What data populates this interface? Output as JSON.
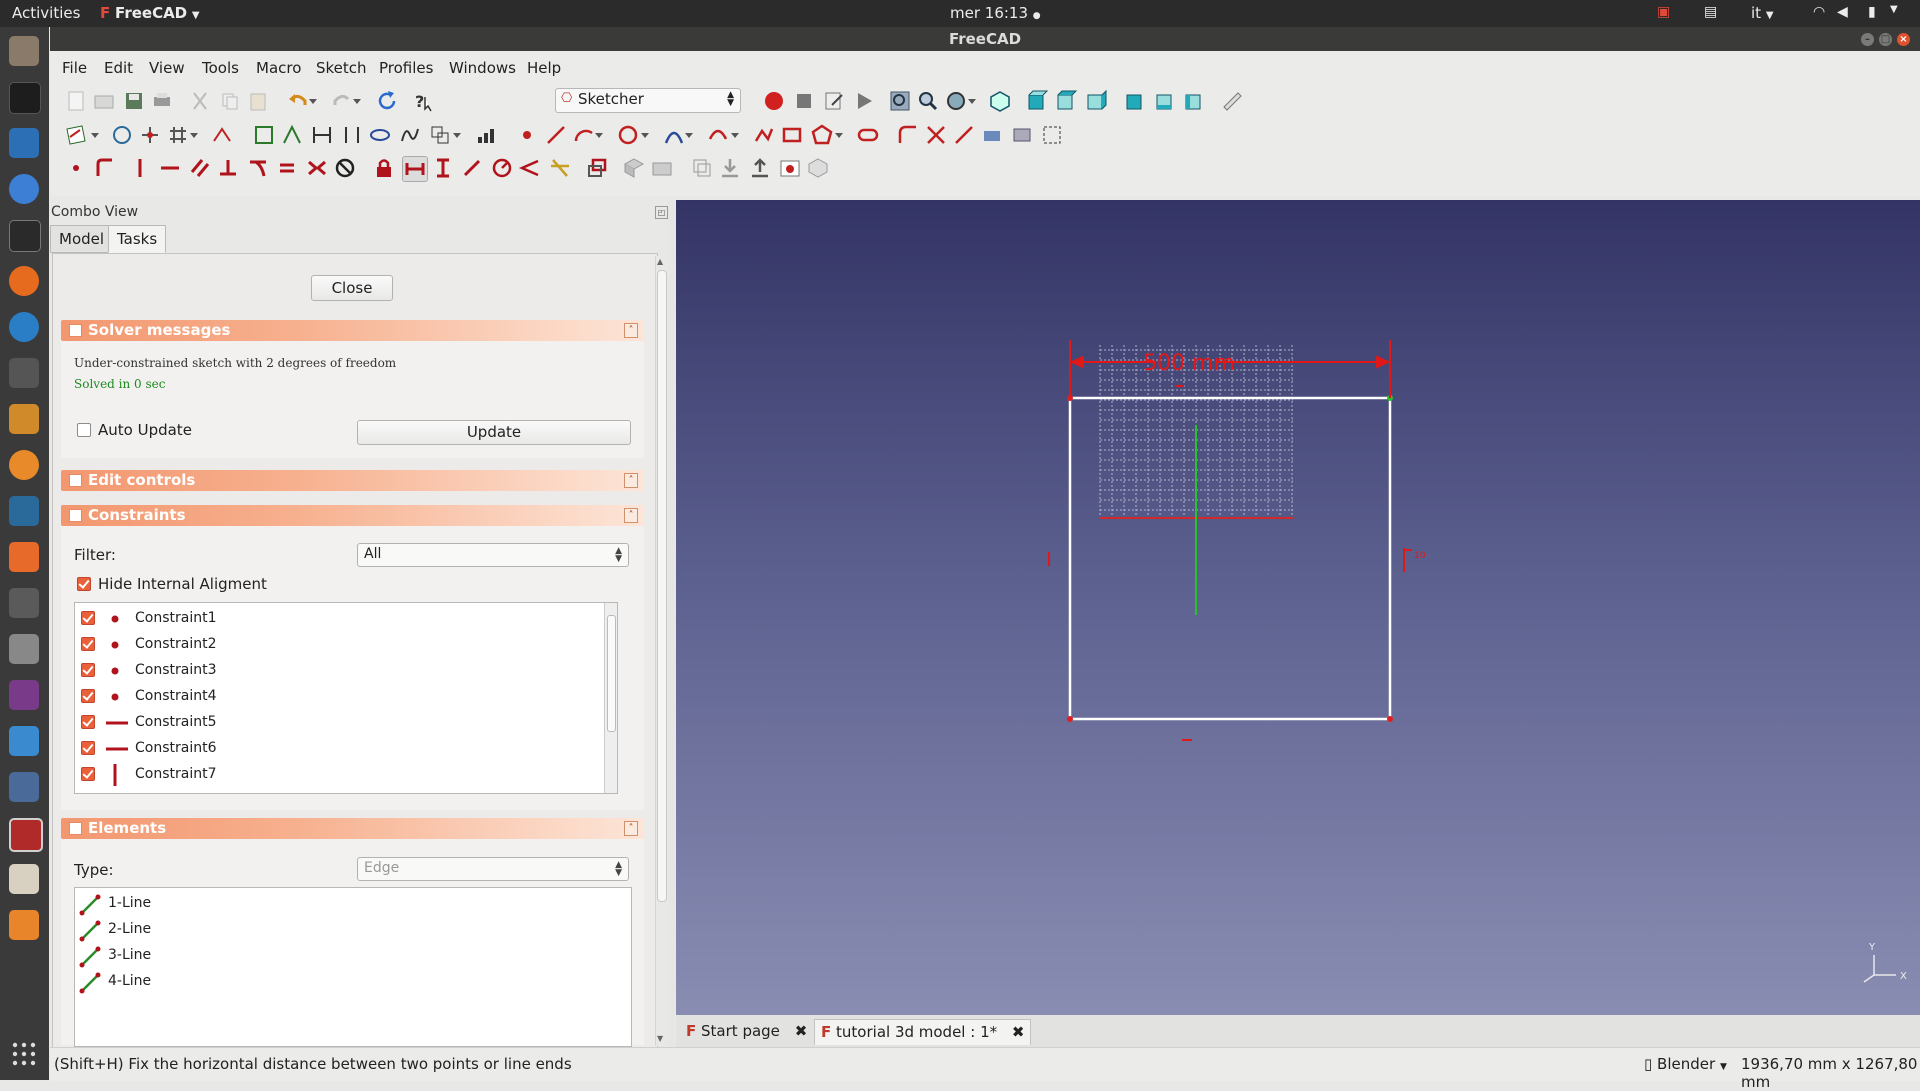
{
  "topbar": {
    "activities": "Activities",
    "app_name": "FreeCAD",
    "clock": "mer 16:13",
    "lang": "it"
  },
  "window": {
    "title": "FreeCAD"
  },
  "menu": [
    "File",
    "Edit",
    "View",
    "Tools",
    "Macro",
    "Sketch",
    "Profiles",
    "Windows",
    "Help"
  ],
  "toolbar": {
    "workbench": "Sketcher"
  },
  "combo": {
    "title": "Combo View",
    "tabs": [
      "Model",
      "Tasks"
    ],
    "close_label": "Close"
  },
  "solver": {
    "title": "Solver messages",
    "message": "Under-constrained sketch with 2 degrees of freedom",
    "solved": "Solved in 0 sec",
    "auto_update": "Auto Update",
    "update": "Update"
  },
  "edit_controls": {
    "title": "Edit controls"
  },
  "constraints": {
    "title": "Constraints",
    "filter_label": "Filter:",
    "filter_value": "All",
    "hide_internal": "Hide Internal Aligment",
    "items": [
      {
        "name": "Constraint1",
        "icon": "coincident-point-icon"
      },
      {
        "name": "Constraint2",
        "icon": "coincident-point-icon"
      },
      {
        "name": "Constraint3",
        "icon": "coincident-point-icon"
      },
      {
        "name": "Constraint4",
        "icon": "coincident-point-icon"
      },
      {
        "name": "Constraint5",
        "icon": "horizontal-icon"
      },
      {
        "name": "Constraint6",
        "icon": "horizontal-icon"
      },
      {
        "name": "Constraint7",
        "icon": "vertical-icon"
      }
    ]
  },
  "elements": {
    "title": "Elements",
    "type_label": "Type:",
    "type_value": "Edge",
    "items": [
      "1-Line",
      "2-Line",
      "3-Line",
      "4-Line"
    ]
  },
  "view": {
    "dimension_label": "500 mm",
    "small_label": "10",
    "axis_x": "X",
    "axis_y": "Y",
    "tabs": [
      "Start page",
      "tutorial 3d model : 1*"
    ]
  },
  "status": {
    "hint": "(Shift+H) Fix the horizontal distance between two points or line ends",
    "nav_style": "Blender",
    "dimensions": "1936,70 mm x 1267,80 mm"
  },
  "colors": {
    "section_header": "#f2976f",
    "constraint_red": "#b0131b",
    "checkbox_on": "#e9603a",
    "view_top": "#333465",
    "view_bottom": "#8a8db2"
  }
}
